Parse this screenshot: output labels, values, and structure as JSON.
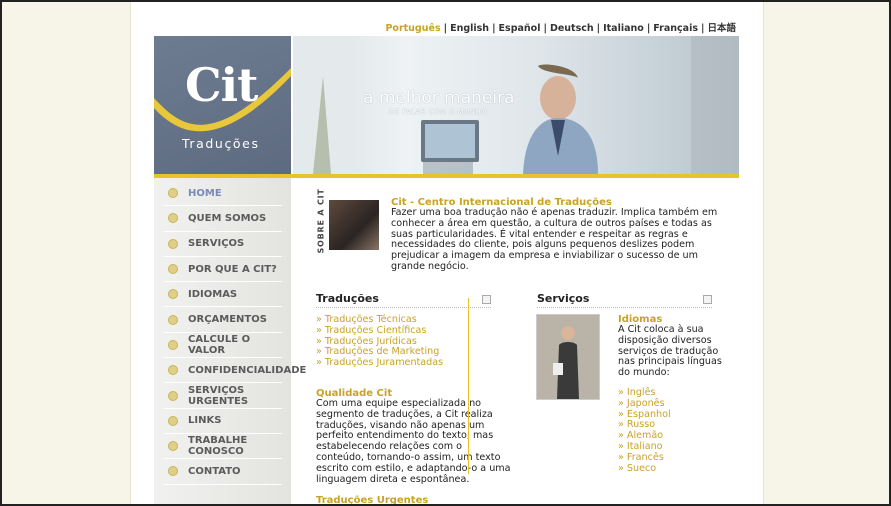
{
  "languages": [
    {
      "label": "Português",
      "selected": true
    },
    {
      "label": "English",
      "selected": false
    },
    {
      "label": "Español",
      "selected": false
    },
    {
      "label": "Deutsch",
      "selected": false
    },
    {
      "label": "Italiano",
      "selected": false
    },
    {
      "label": "Français",
      "selected": false
    },
    {
      "label": "日本語",
      "selected": false
    }
  ],
  "logo": {
    "name": "Cit",
    "subtitle": "Traduções"
  },
  "banner": {
    "slogan": "a melhor maneira",
    "slogan_sub": "DE FALAR COM O MUNDO"
  },
  "menu": [
    "HOME",
    "QUEM SOMOS",
    "SERVIÇOS",
    "POR QUE A CIT?",
    "IDIOMAS",
    "ORÇAMENTOS",
    "CALCULE O VALOR",
    "CONFIDENCIALIDADE",
    "SERVIÇOS URGENTES",
    "LINKS",
    "TRABALHE CONOSCO",
    "CONTATO"
  ],
  "about": {
    "side_label": "SOBRE A CIT",
    "title": "Cit - Centro Internacional de Traduções",
    "text": "Fazer uma boa tradução não é apenas traduzir. Implica também em conhecer a área em questão, a cultura de outros países e todas as suas particularidades. É vital entender e respeitar as regras e necessidades do cliente, pois alguns pequenos deslizes podem prejudicar a imagem da empresa e inviabilizar o sucesso de um grande negócio."
  },
  "traducoes": {
    "heading": "Traduções",
    "links": [
      "» Traduções Técnicas",
      "» Traduções Científicas",
      "» Traduções Jurídicas",
      "» Traduções de Marketing",
      "» Traduções Juramentadas"
    ],
    "quality_title": "Qualidade Cit",
    "quality_text": "Com uma equipe especializada no segmento de traduções, a Cit realiza traduções, visando não apenas um perfeito entendimento do texto, mas estabelecendo relações com o conteúdo, tornando-o assim, um texto escrito com estilo, e adaptando-o a uma linguagem direta e espontânea.",
    "next_title": "Traduções Urgentes"
  },
  "servicos": {
    "heading": "Serviços",
    "idiomas_title": "Idiomas",
    "idiomas_text": "A Cit coloca à sua disposição diversos serviços de tradução nas principais línguas do mundo:",
    "languages": [
      "» Inglês",
      "» Japonês",
      "» Espanhol",
      "» Russo",
      "» Alemão",
      "» Italiano",
      "» Francês",
      "» Sueco"
    ]
  },
  "colors": {
    "accent": "#c9a226",
    "yellow_line": "#e3c62c",
    "logo_bg": "#6e7c92",
    "menu_active": "#7a8ab8"
  }
}
